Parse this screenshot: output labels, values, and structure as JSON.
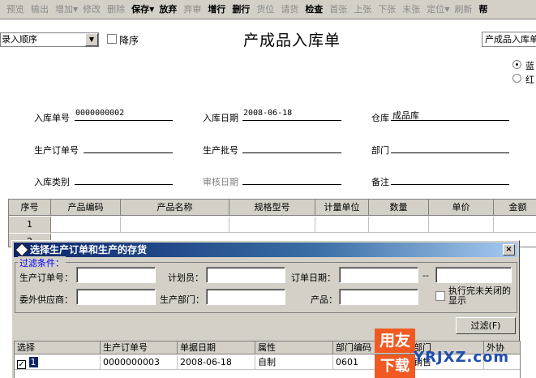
{
  "toolbar": {
    "items": [
      {
        "label": "预览",
        "enabled": false
      },
      {
        "label": "输出",
        "enabled": false
      },
      {
        "label": "增加",
        "enabled": false,
        "dropdown": true
      },
      {
        "label": "修改",
        "enabled": false
      },
      {
        "label": "删除",
        "enabled": false
      },
      {
        "label": "保存",
        "enabled": true,
        "dropdown": true
      },
      {
        "label": "放弃",
        "enabled": true
      },
      {
        "label": "弃审",
        "enabled": false
      },
      {
        "label": "增行",
        "enabled": true
      },
      {
        "label": "删行",
        "enabled": true
      },
      {
        "label": "货位",
        "enabled": false
      },
      {
        "label": "请货",
        "enabled": false
      },
      {
        "label": "检查",
        "enabled": true
      },
      {
        "label": "首张",
        "enabled": false
      },
      {
        "label": "上张",
        "enabled": false
      },
      {
        "label": "下张",
        "enabled": false
      },
      {
        "label": "末张",
        "enabled": false
      },
      {
        "label": "定位",
        "enabled": false,
        "dropdown": true
      },
      {
        "label": "刷新",
        "enabled": false
      },
      {
        "label": "帮",
        "enabled": true
      }
    ]
  },
  "header": {
    "order_select": "录入顺序",
    "desc_label": "降序",
    "title": "产成品入库单",
    "template_select": "产成品入库单",
    "radio_blue": "蓝",
    "radio_red": "红"
  },
  "fields": {
    "receipt_no_label": "入库单号",
    "receipt_no": "0000000002",
    "receipt_date_label": "入库日期",
    "receipt_date": "2008-06-18",
    "warehouse_label": "仓库",
    "warehouse": "成品库",
    "prod_order_label": "生产订单号",
    "prod_batch_label": "生产批号",
    "dept_label": "部门",
    "receipt_type_label": "入库类别",
    "audit_date_label": "审核日期",
    "remark_label": "备注"
  },
  "grid": {
    "columns": [
      "序号",
      "产品编码",
      "产品名称",
      "规格型号",
      "计量单位",
      "数量",
      "单价",
      "金额"
    ],
    "rows": [
      "1",
      "2"
    ]
  },
  "dialog": {
    "title": "选择生产订单和生产的存货",
    "close": "×",
    "group_legend": "过滤条件：",
    "prod_order_label": "生产订单号：",
    "planner_label": "计划员：",
    "order_date_label": "订单日期：",
    "date_sep": "--",
    "outsource_label": "委外供应商：",
    "prod_dept_label": "生产部门：",
    "product_label": "产品：",
    "show_unclosed_label": "执行完未关闭的显示",
    "filter_button": "过滤(F)",
    "columns": [
      "选择",
      "生产订单号",
      "单据日期",
      "属性",
      "部门编码",
      "部门",
      "外协"
    ],
    "row": {
      "num": "1",
      "order_no": "0000000003",
      "date": "2008-06-18",
      "attr": "自制",
      "dept_code": "0601",
      "dept": "销售"
    }
  },
  "watermark": {
    "top": "用友",
    "bottom": "下载",
    "site": "YRJXZ.com",
    "sub": "YRJXZ.com"
  },
  "colors": {
    "toolbar_bg": "#d4d0c8",
    "title_bar": "#0a246a",
    "filter_text": "#0000ff",
    "watermark": "#f05a22"
  }
}
